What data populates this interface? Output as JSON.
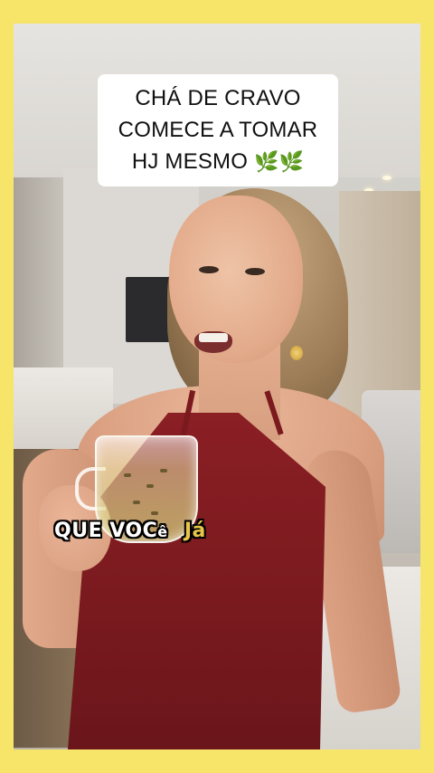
{
  "title_card": {
    "lines": [
      "CHÁ DE CRAVO",
      "COMECE A TOMAR",
      "HJ MESMO"
    ],
    "emoji": "🌿🌿"
  },
  "caption": {
    "word1": "QUE",
    "word2_main": "VOC",
    "word2_small": "ê",
    "word3": "Já"
  },
  "colors": {
    "frame_background": "#f7e56a",
    "caption_highlight": "#e7c54a",
    "dress": "#7a1a1f"
  }
}
